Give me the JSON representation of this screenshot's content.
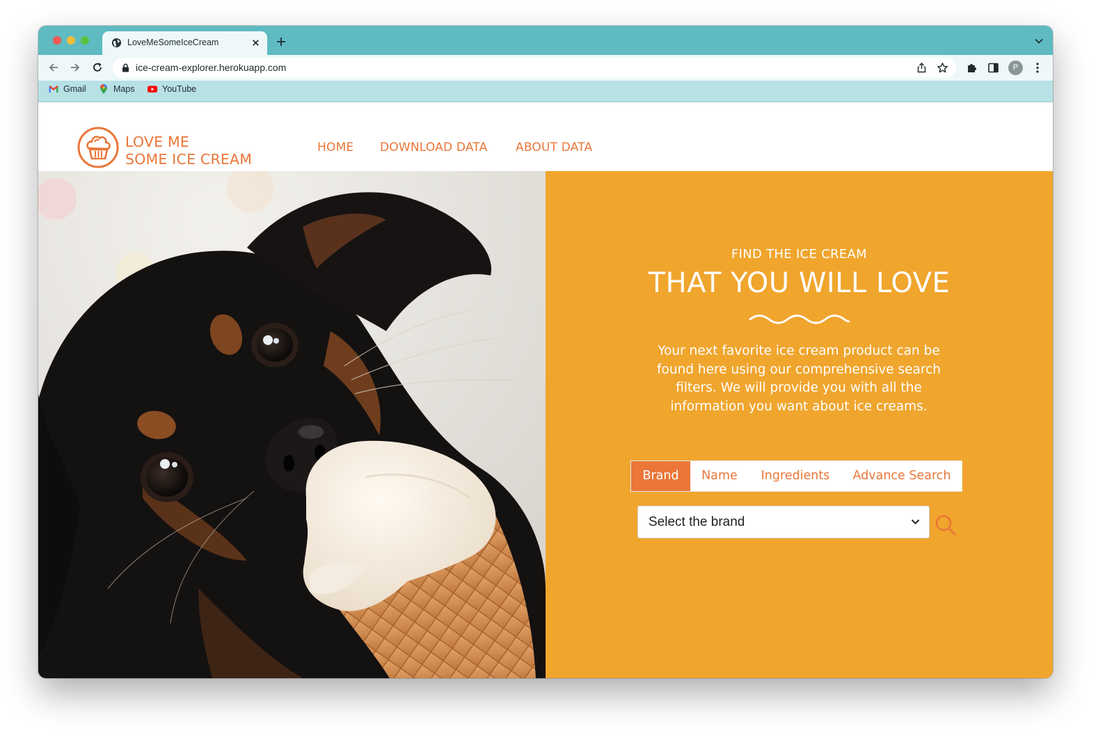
{
  "browser": {
    "tab_title": "LoveMeSomeIceCream",
    "url": "ice-cream-explorer.herokuapp.com",
    "avatar_initial": "P",
    "bookmarks": [
      {
        "label": "Gmail",
        "icon": "gmail-icon"
      },
      {
        "label": "Maps",
        "icon": "maps-icon"
      },
      {
        "label": "YouTube",
        "icon": "youtube-icon"
      }
    ]
  },
  "site": {
    "logo_line1": "LOVE ME",
    "logo_line2": "SOME ICE CREAM",
    "nav": [
      {
        "label": "HOME"
      },
      {
        "label": "DOWNLOAD DATA"
      },
      {
        "label": "ABOUT DATA"
      }
    ]
  },
  "hero": {
    "kicker": "FIND THE ICE CREAM",
    "headline": "THAT YOU WILL LOVE",
    "blurb": "Your next favorite ice cream product can be found here using our comprehensive search filters. We will provide you with all the information you want about ice creams.",
    "image_icon": "dog-with-ice-cream-cone-photo",
    "search_tabs": [
      {
        "label": "Brand",
        "active": true
      },
      {
        "label": "Name",
        "active": false
      },
      {
        "label": "Ingredients",
        "active": false
      },
      {
        "label": "Advance Search",
        "active": false
      }
    ],
    "select_value": "Select the brand",
    "search_icon": "search-icon"
  },
  "colors": {
    "tabstrip": "#5fbac2",
    "toolbar": "#eef8f9",
    "bookmarks_bar": "#b7e1e5",
    "brand_orange": "#ea7638",
    "panel_orange": "#f0a52d"
  }
}
